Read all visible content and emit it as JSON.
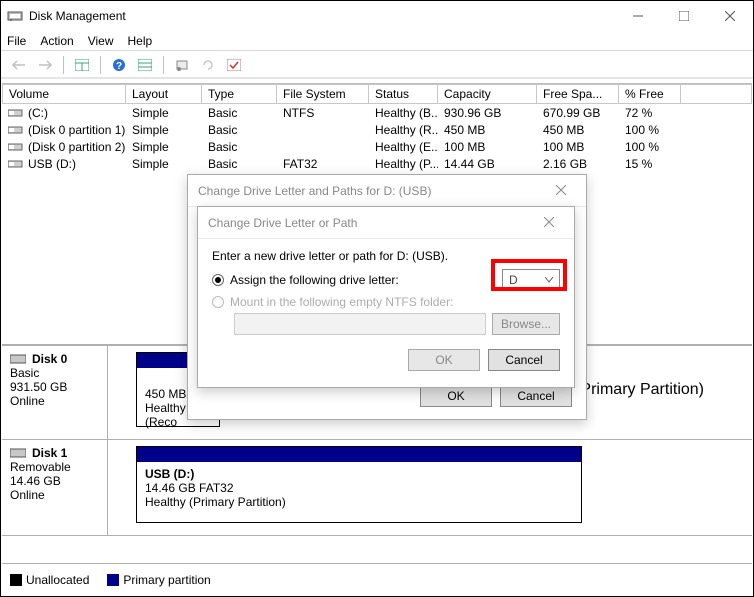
{
  "window": {
    "title": "Disk Management"
  },
  "menubar": [
    "File",
    "Action",
    "View",
    "Help"
  ],
  "columns": [
    "Volume",
    "Layout",
    "Type",
    "File System",
    "Status",
    "Capacity",
    "Free Spa...",
    "% Free"
  ],
  "rows": [
    {
      "vol": "(C:)",
      "layout": "Simple",
      "type": "Basic",
      "fs": "NTFS",
      "status": "Healthy (B...",
      "cap": "930.96 GB",
      "free": "670.99 GB",
      "pct": "72 %"
    },
    {
      "vol": "(Disk 0 partition 1)",
      "layout": "Simple",
      "type": "Basic",
      "fs": "",
      "status": "Healthy (R...",
      "cap": "450 MB",
      "free": "450 MB",
      "pct": "100 %"
    },
    {
      "vol": "(Disk 0 partition 2)",
      "layout": "Simple",
      "type": "Basic",
      "fs": "",
      "status": "Healthy (E...",
      "cap": "100 MB",
      "free": "100 MB",
      "pct": "100 %"
    },
    {
      "vol": "USB (D:)",
      "layout": "Simple",
      "type": "Basic",
      "fs": "FAT32",
      "status": "Healthy (P...",
      "cap": "14.44 GB",
      "free": "2.16 GB",
      "pct": "15 %"
    }
  ],
  "disk0": {
    "name": "Disk 0",
    "type": "Basic",
    "size": "931.50 GB",
    "status": "Online",
    "part1_line1": "450 MB",
    "part1_line2": "Healthy (Reco",
    "trail": "mp, Primary Partition)"
  },
  "disk1": {
    "name": "Disk 1",
    "type": "Removable",
    "size": "14.46 GB",
    "status": "Online",
    "part_title": "USB  (D:)",
    "part_line1": "14.46 GB FAT32",
    "part_line2": "Healthy (Primary Partition)"
  },
  "legend": {
    "unalloc": "Unallocated",
    "primary": "Primary partition"
  },
  "dlg1": {
    "title": "Change Drive Letter and Paths for D: (USB)",
    "ok": "OK",
    "cancel": "Cancel"
  },
  "dlg2": {
    "title": "Change Drive Letter or Path",
    "prompt": "Enter a new drive letter or path for D: (USB).",
    "opt1": "Assign the following drive letter:",
    "opt2": "Mount in the following empty NTFS folder:",
    "letter": "D",
    "browse": "Browse...",
    "ok": "OK",
    "cancel": "Cancel"
  }
}
